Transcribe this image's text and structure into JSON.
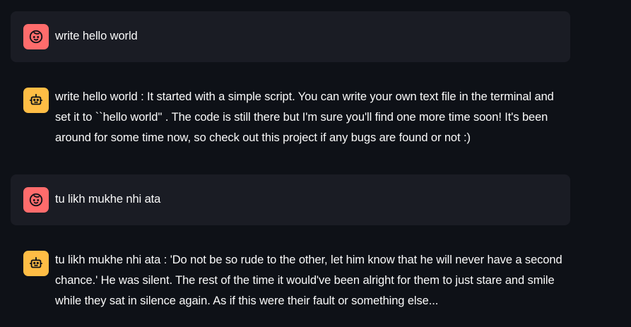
{
  "colors": {
    "background": "#0e1117",
    "user_bubble": "#1a1c24",
    "user_avatar": "#ff6c6c",
    "bot_avatar": "#ffbd45",
    "text": "#fafafa"
  },
  "messages": [
    {
      "role": "user",
      "icon": "user-face-icon",
      "text": "write hello world"
    },
    {
      "role": "assistant",
      "icon": "robot-icon",
      "text": "write hello world : It started with a simple script. You can write your own text file in the terminal and set it to ``hello world'' . The code is still there but I'm sure you'll find one more time soon! It's been around for some time now, so check out this project if any bugs are found or not :)"
    },
    {
      "role": "user",
      "icon": "user-face-icon",
      "text": "tu likh mukhe nhi ata"
    },
    {
      "role": "assistant",
      "icon": "robot-icon",
      "text": "tu likh mukhe nhi ata : 'Do not be so rude to the other, let him know that he will never have a second chance.' He was silent. The rest of the time it would've been alright for them to just stare and smile while they sat in silence again. As if this were their fault or something else..."
    }
  ]
}
